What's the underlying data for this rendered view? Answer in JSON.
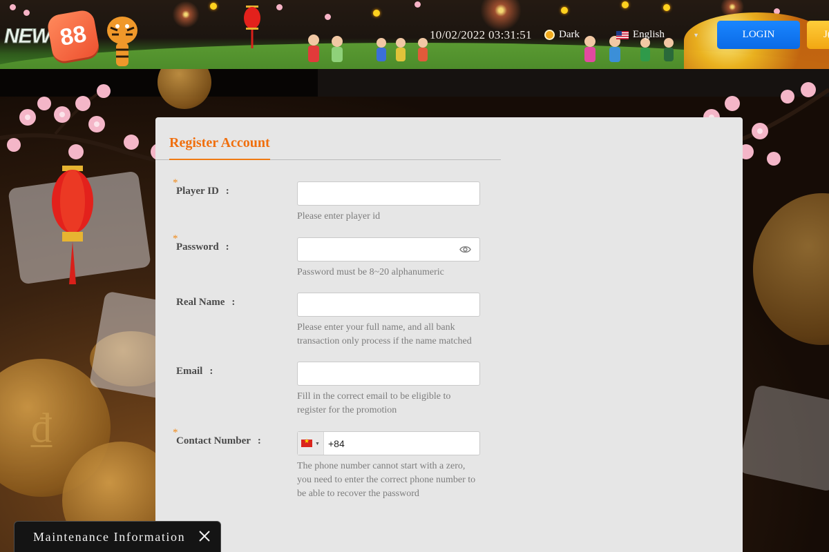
{
  "header": {
    "logo": {
      "wordmark": "NEW",
      "number": "88"
    },
    "datetime": "10/02/2022 03:31:51",
    "theme_toggle_label": "Dark",
    "language": {
      "selected": "English",
      "flag_icon": "us-flag-icon"
    },
    "login_label": "LOGIN",
    "join_label": "J("
  },
  "form": {
    "title": "Register Account",
    "fields": [
      {
        "label": "Player ID",
        "colon": ":",
        "required": "*",
        "hint": "Please enter player id",
        "value": ""
      },
      {
        "label": "Password",
        "colon": ":",
        "required": "*",
        "hint": "Password must be 8~20 alphanumeric",
        "value": ""
      },
      {
        "label": "Real Name",
        "colon": ":",
        "required": "",
        "hint": "Please enter your full name, and all bank transaction only process if the name matched",
        "value": ""
      },
      {
        "label": "Email",
        "colon": ":",
        "required": "",
        "hint": "Fill in the correct email to be eligible to register for the promotion",
        "value": ""
      },
      {
        "label": "Contact Number",
        "colon": ":",
        "required": "*",
        "hint": "The phone number cannot start with a zero, you need to enter the correct phone number to be able to recover the password",
        "value": "+84",
        "country_flag_icon": "vietnam-flag-icon"
      }
    ]
  },
  "maintenance": {
    "label": "Maintenance Information"
  },
  "colors": {
    "accent_orange": "#f06f0e",
    "login_blue": "#0a6ae6",
    "join_yellow": "#f2a712",
    "panel_bg": "#e6e6e6"
  }
}
